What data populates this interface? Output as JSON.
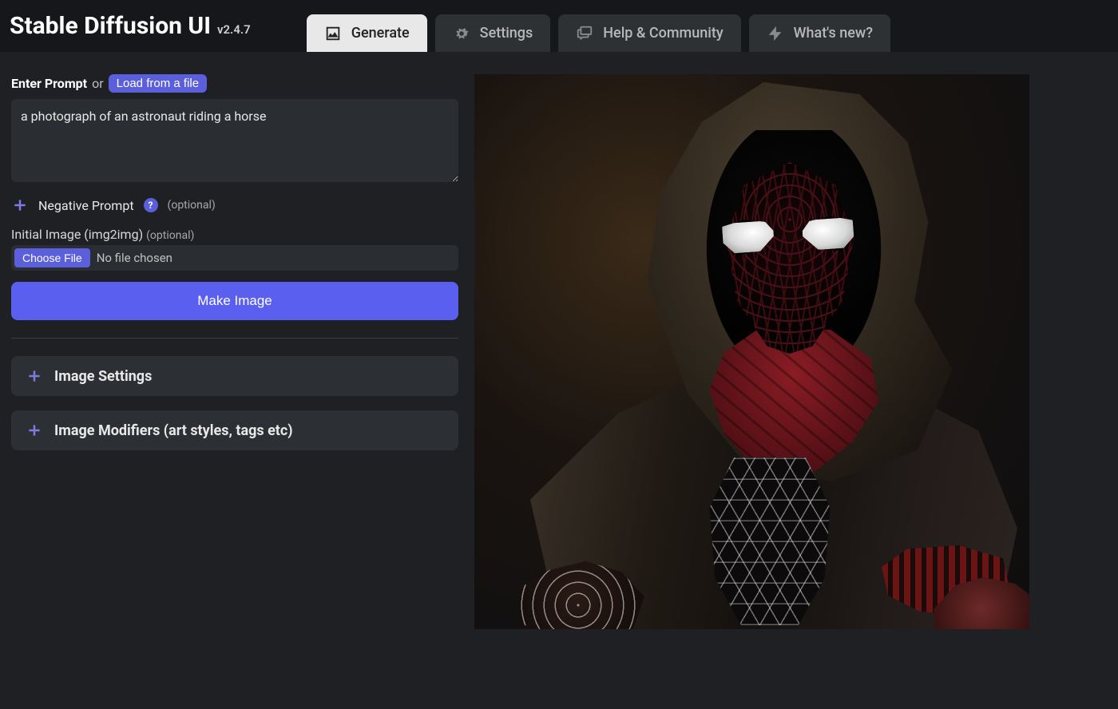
{
  "header": {
    "title": "Stable Diffusion UI",
    "version": "v2.4.7",
    "tabs": {
      "generate": "Generate",
      "settings": "Settings",
      "help": "Help & Community",
      "whatsnew": "What's new?"
    }
  },
  "prompt": {
    "label": "Enter Prompt",
    "or": "or",
    "load_file": "Load from a file",
    "value": "a photograph of an astronaut riding a horse"
  },
  "negative": {
    "label": "Negative Prompt",
    "help": "?",
    "optional": "(optional)"
  },
  "initial": {
    "label": "Initial Image (img2img)",
    "optional": "(optional)",
    "choose": "Choose File",
    "status": "No file chosen"
  },
  "make_button": "Make Image",
  "expanders": {
    "image_settings": "Image Settings",
    "image_modifiers": "Image Modifiers (art styles, tags etc)"
  }
}
